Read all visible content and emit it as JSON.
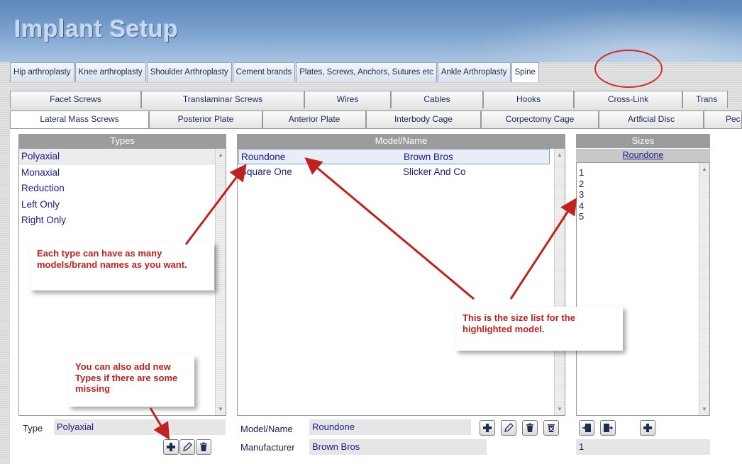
{
  "app": {
    "title": "Implant Setup"
  },
  "main_tabs": [
    "Hip arthroplasty",
    "Knee arthroplasty",
    "Shoulder Arthroplasty",
    "Cement brands",
    "Plates, Screws, Anchors, Sutures etc",
    "Ankle Arthroplasty",
    "Spine"
  ],
  "sub_tabs_top": [
    "Facet Screws",
    "Translaminar Screws",
    "Wires",
    "Cables",
    "Hooks",
    "Cross-Link",
    "Trans"
  ],
  "sub_tabs_bottom": [
    "Lateral Mass Screws",
    "Posterior Plate",
    "Anterior Plate",
    "Interbody Cage",
    "Corpectomy Cage",
    "Artficial Disc",
    "Pec"
  ],
  "types": {
    "header": "Types",
    "items": [
      "Polyaxial",
      "Monaxial",
      "Reduction",
      "Left Only",
      "Right Only"
    ],
    "selected_index": 0,
    "type_label": "Type",
    "type_value": "Polyaxial"
  },
  "models": {
    "header": "Model/Name",
    "rows": [
      {
        "name": "Roundone",
        "manufacturer": "Brown Bros"
      },
      {
        "name": "Square One",
        "manufacturer": "Slicker And Co"
      }
    ],
    "selected_index": 0,
    "model_label": "Model/Name",
    "model_value": "Roundone",
    "manufacturer_label": "Manufacturer",
    "manufacturer_value": "Brown Bros"
  },
  "sizes": {
    "header": "Sizes",
    "model": "Roundone",
    "items": [
      "1",
      "2",
      "3",
      "4",
      "5"
    ],
    "current_value": "1"
  },
  "annotations": {
    "note_models": "Each type can have as many models/brand names as you want.",
    "note_sizes": "This is the size list for the highlighted model.",
    "note_types": "You can also add new Types if there are some missing"
  },
  "colors": {
    "header_blue": "#6f98c8",
    "annotation_red": "#c0221f",
    "panel_header_gray": "#9c9c9c",
    "list_text": "#1a1a8a"
  }
}
